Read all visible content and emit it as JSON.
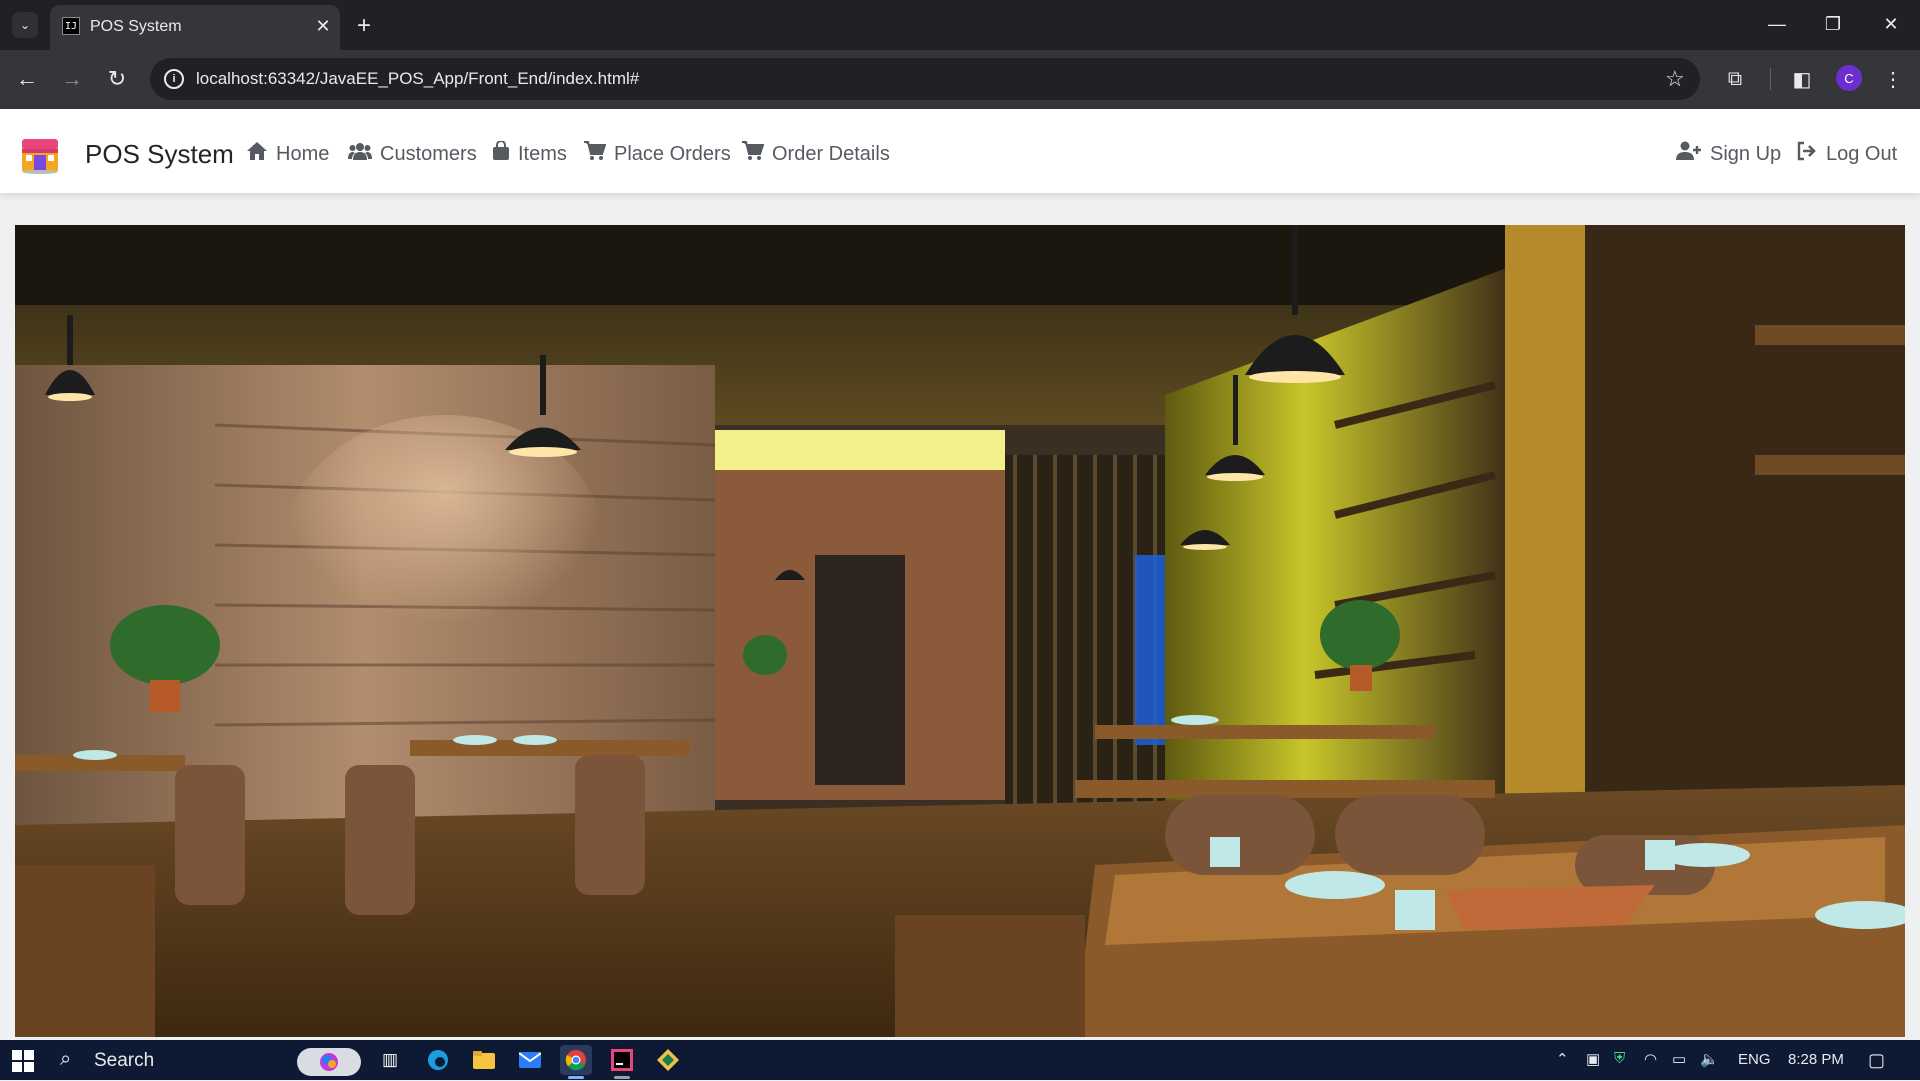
{
  "browser": {
    "tab_title": "POS System",
    "tab_favicon": "IJ",
    "url": "localhost:63342/JavaEE_POS_App/Front_End/index.html#",
    "profile_initial": "C"
  },
  "navbar": {
    "brand": "POS System",
    "links": [
      {
        "label": "Home",
        "icon": "home-icon"
      },
      {
        "label": "Customers",
        "icon": "users-icon"
      },
      {
        "label": "Items",
        "icon": "bag-icon"
      },
      {
        "label": "Place Orders",
        "icon": "cart-icon"
      },
      {
        "label": "Order Details",
        "icon": "cart-icon"
      }
    ],
    "right_links": [
      {
        "label": "Sign Up",
        "icon": "user-plus-icon"
      },
      {
        "label": "Log Out",
        "icon": "logout-icon"
      }
    ]
  },
  "taskbar": {
    "search_label": "Search",
    "language": "ENG",
    "time": "8:28 PM"
  },
  "colors": {
    "navbar_bg": "#ffffff",
    "nav_text": "#555b61",
    "taskbar_bg": "#0e1a33",
    "browser_dark": "#35363a"
  }
}
